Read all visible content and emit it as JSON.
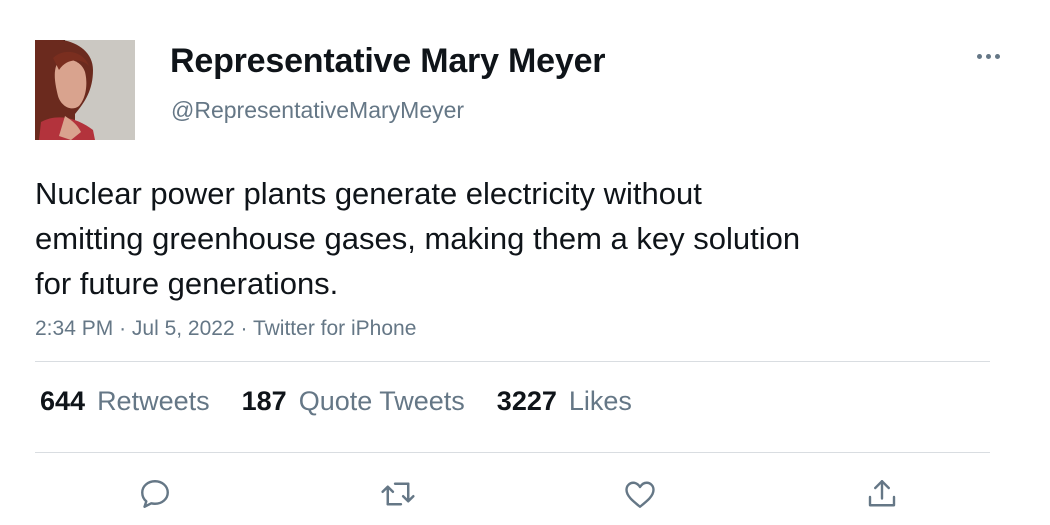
{
  "author": {
    "name": "Representative Mary Meyer",
    "handle": "@RepresentativeMaryMeyer"
  },
  "tweet": {
    "text_lines": [
      "Nuclear power plants generate electricity without",
      "emitting greenhouse gases, making them a key solution",
      "for future generations."
    ],
    "time": "2:34 PM",
    "separator": "·",
    "date": "Jul 5, 2022",
    "source": "Twitter for iPhone"
  },
  "stats": {
    "retweets": {
      "count": "644",
      "label": "Retweets"
    },
    "quote_tweets": {
      "count": "187",
      "label": "Quote Tweets"
    },
    "likes": {
      "count": "3227",
      "label": "Likes"
    }
  },
  "actions": [
    "reply-icon",
    "retweet-icon",
    "like-icon",
    "share-icon"
  ],
  "colors": {
    "text": "#0f1419",
    "secondary": "#657786",
    "divider": "#d9dde1",
    "background": "#ffffff"
  }
}
